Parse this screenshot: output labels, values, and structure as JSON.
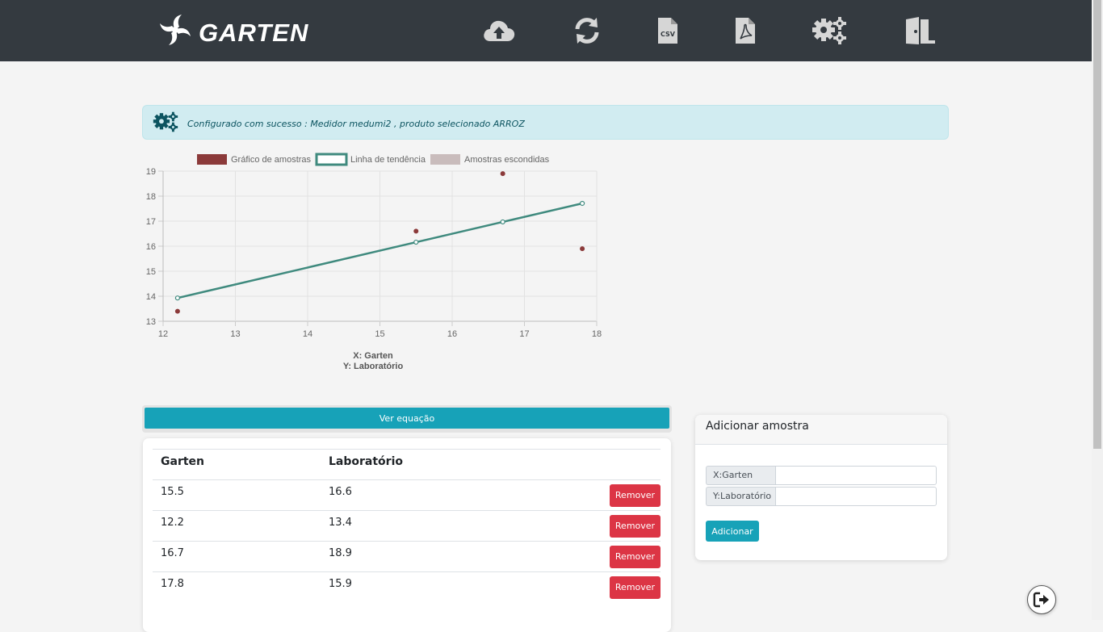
{
  "header": {
    "brand": "GARTEN",
    "icons": [
      {
        "name": "cloud-upload-icon"
      },
      {
        "name": "sync-icon"
      },
      {
        "name": "csv-file-icon",
        "label": "CSV"
      },
      {
        "name": "pdf-file-icon"
      },
      {
        "name": "gears-icon"
      },
      {
        "name": "exit-door-icon"
      }
    ]
  },
  "alert": {
    "icon": "gears-icon",
    "text": "Configurado com sucesso : Medidor medumi2 , produto selecionado ARROZ"
  },
  "chart_data": {
    "type": "scatter",
    "legend": [
      "Gráfico de amostras",
      "Linha de tendência",
      "Amostras escondidas"
    ],
    "legend_placement": "top",
    "xlabel": "X: Garten",
    "ylabel": "Y: Laboratório",
    "xlim": [
      12,
      18
    ],
    "ylim": [
      13,
      19
    ],
    "x_ticks": [
      "12",
      "13",
      "14",
      "15",
      "16",
      "17",
      "18"
    ],
    "y_ticks": [
      "19",
      "18",
      "17",
      "16",
      "15",
      "14",
      "13"
    ],
    "grid": true,
    "colors": {
      "samples": "#8b3a3a",
      "trend": "#3f8a7e",
      "hidden": "#c9bcbc"
    },
    "series": [
      {
        "name": "Gráfico de amostras",
        "points": [
          [
            15.5,
            16.6
          ],
          [
            12.2,
            13.4
          ],
          [
            16.7,
            18.9
          ],
          [
            17.8,
            15.9
          ]
        ]
      },
      {
        "name": "Linha de tendência",
        "points": [
          [
            12.2,
            13.93
          ],
          [
            15.5,
            16.16
          ],
          [
            16.7,
            16.97
          ],
          [
            17.8,
            17.71
          ]
        ]
      }
    ]
  },
  "equation_button": "Ver equação",
  "table": {
    "headers": [
      "Garten",
      "Laboratório"
    ],
    "remove_label": "Remover",
    "rows": [
      {
        "x": "15.5",
        "y": "16.6"
      },
      {
        "x": "12.2",
        "y": "13.4"
      },
      {
        "x": "16.7",
        "y": "18.9"
      },
      {
        "x": "17.8",
        "y": "15.9"
      }
    ]
  },
  "add_form": {
    "title": "Adicionar amostra",
    "x_label": "X:Garten",
    "y_label": "Y:Laboratório",
    "x_value": "",
    "y_value": "",
    "submit": "Adicionar"
  },
  "fab_icon": "sign-out-icon"
}
